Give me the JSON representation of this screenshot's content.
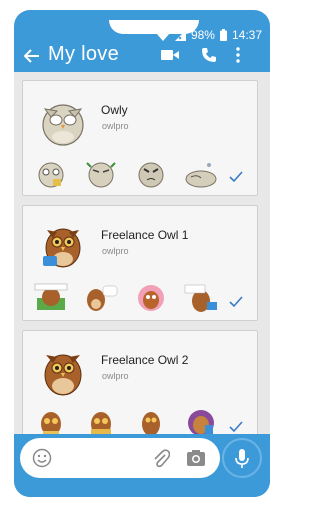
{
  "status": {
    "battery": "98%",
    "time": "14:37"
  },
  "header": {
    "title": "My love"
  },
  "packs": [
    {
      "name": "Owly",
      "publisher": "owlpro"
    },
    {
      "name": "Freelance Owl 1",
      "publisher": "owlpro"
    },
    {
      "name": "Freelance Owl 2",
      "publisher": "owlpro"
    }
  ],
  "colors": {
    "brand": "#3d9ad8",
    "check": "#3a7cc4"
  }
}
